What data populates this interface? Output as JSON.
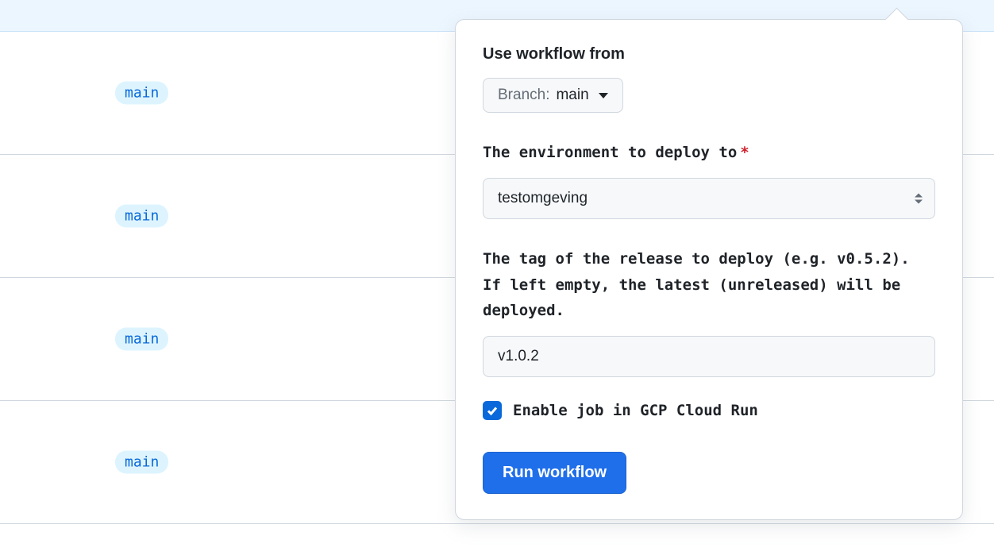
{
  "list": {
    "branch_label": "main"
  },
  "popup": {
    "heading": "Use workflow from",
    "branch_prefix": "Branch:",
    "branch_value": "main",
    "env_label": "The environment to deploy to",
    "env_value": "testomgeving",
    "tag_label": "The tag of the release to deploy (e.g. v0.5.2). If left empty, the latest (unreleased) will be deployed.",
    "tag_value": "v1.0.2",
    "checkbox_label": "Enable job in GCP Cloud Run",
    "checkbox_checked": true,
    "run_button": "Run workflow"
  }
}
